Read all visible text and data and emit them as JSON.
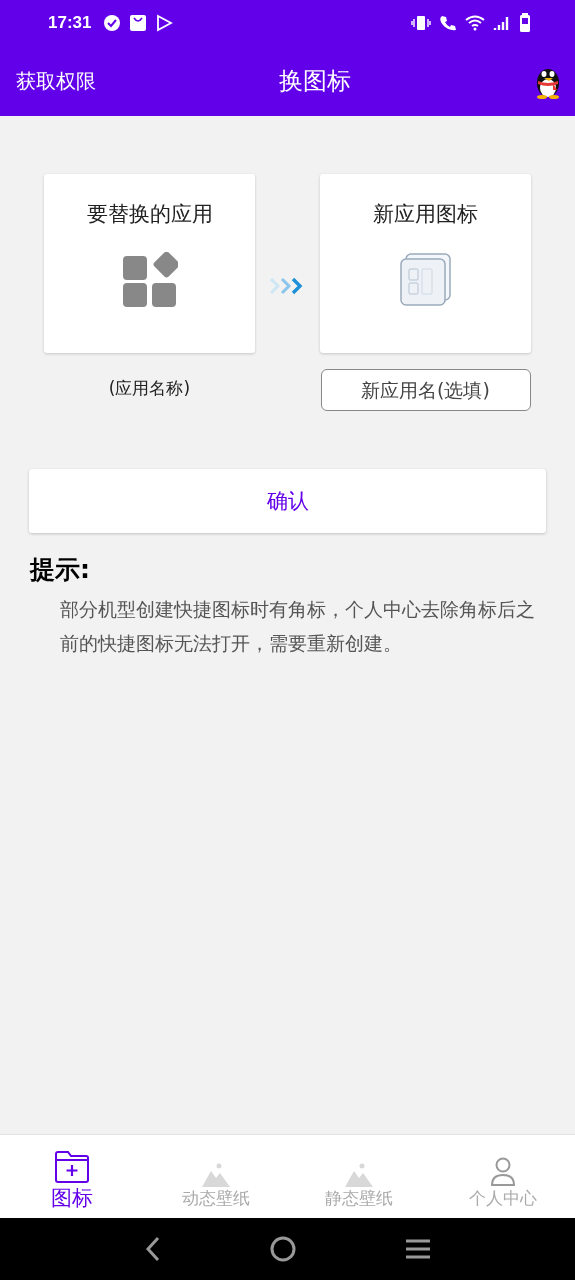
{
  "status_bar": {
    "time": "17:31"
  },
  "app_bar": {
    "left_action": "获取权限",
    "title": "换图标"
  },
  "source_card": {
    "title": "要替换的应用",
    "caption": "(应用名称)"
  },
  "target_card": {
    "title": "新应用图标",
    "name_field": {
      "placeholder": "新应用名(选填)"
    }
  },
  "confirm_button": "确认",
  "hint": {
    "title": "提示:",
    "text": "部分机型创建快捷图标时有角标，个人中心去除角标后之前的快捷图标无法打开，需要重新创建。"
  },
  "tabs": [
    {
      "label": "图标",
      "kind": "folder",
      "selected": true
    },
    {
      "label": "动态壁纸",
      "kind": "mountain",
      "selected": false
    },
    {
      "label": "静态壁纸",
      "kind": "mountain",
      "selected": false
    },
    {
      "label": "个人中心",
      "kind": "person",
      "selected": false
    }
  ]
}
